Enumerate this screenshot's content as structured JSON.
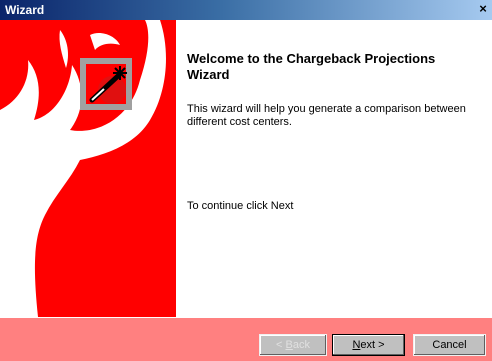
{
  "window": {
    "title": "Wizard",
    "close_glyph": "×"
  },
  "welcome": {
    "heading": "Welcome to the Chargeback Projections Wizard",
    "description": "This wizard will help you generate a comparison between different cost centers.",
    "continue_hint": "To continue click Next"
  },
  "sidebar": {
    "image": "deer-antler-wand-graphic",
    "background_color": "#ff0000"
  },
  "buttons": {
    "back_prefix": "< ",
    "back_access": "B",
    "back_rest": "ack",
    "next_access": "N",
    "next_rest": "ext >",
    "cancel": "Cancel"
  },
  "colors": {
    "footer": "#ff8080",
    "titlebar_start": "#0a246a",
    "titlebar_end": "#a6caf0"
  }
}
